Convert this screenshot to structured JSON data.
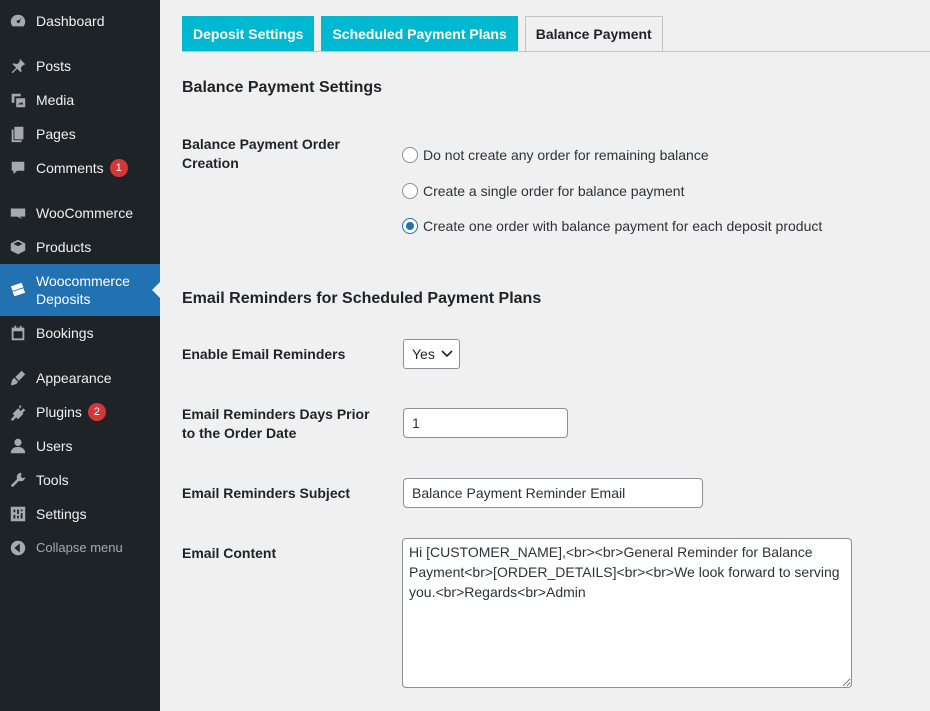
{
  "sidebar": {
    "items": [
      {
        "label": "Dashboard",
        "icon": "dashboard-icon"
      },
      {
        "label": "Posts",
        "icon": "pin-icon"
      },
      {
        "label": "Media",
        "icon": "media-icon"
      },
      {
        "label": "Pages",
        "icon": "pages-icon"
      },
      {
        "label": "Comments",
        "icon": "comments-icon",
        "badge": "1"
      },
      {
        "label": "WooCommerce",
        "icon": "woocommerce-icon"
      },
      {
        "label": "Products",
        "icon": "products-icon"
      },
      {
        "label": "Woocommerce Deposits",
        "icon": "deposits-icon"
      },
      {
        "label": "Bookings",
        "icon": "calendar-icon"
      },
      {
        "label": "Appearance",
        "icon": "brush-icon"
      },
      {
        "label": "Plugins",
        "icon": "plugin-icon",
        "badge": "2"
      },
      {
        "label": "Users",
        "icon": "user-icon"
      },
      {
        "label": "Tools",
        "icon": "wrench-icon"
      },
      {
        "label": "Settings",
        "icon": "settings-icon"
      },
      {
        "label": "Collapse menu",
        "icon": "collapse-icon"
      }
    ]
  },
  "tabs": [
    {
      "label": "Deposit Settings"
    },
    {
      "label": "Scheduled Payment Plans"
    },
    {
      "label": "Balance Payment"
    }
  ],
  "balance": {
    "heading": "Balance Payment Settings",
    "order_creation_label": "Balance Payment Order Creation",
    "options": [
      {
        "label": "Do not create any order for remaining balance",
        "checked": false
      },
      {
        "label": "Create a single order for balance payment",
        "checked": false
      },
      {
        "label": "Create one order with balance payment for each deposit product",
        "checked": true
      }
    ]
  },
  "reminders": {
    "heading": "Email Reminders for Scheduled Payment Plans",
    "enable_label": "Enable Email Reminders",
    "enable_value": "Yes",
    "days_label": "Email Reminders Days Prior to the Order Date",
    "days_value": "1",
    "subject_label": "Email Reminders Subject",
    "subject_value": "Balance Payment Reminder Email",
    "content_label": "Email Content",
    "content_value": "Hi [CUSTOMER_NAME],<br><br>General Reminder for Balance Payment<br>[ORDER_DETAILS]<br><br>We look forward to serving you.<br>Regards<br>Admin"
  },
  "colors": {
    "sidebar": "#1d2327",
    "accent": "#2271b1",
    "tab": "#00b9d1",
    "badge": "#d63638"
  }
}
